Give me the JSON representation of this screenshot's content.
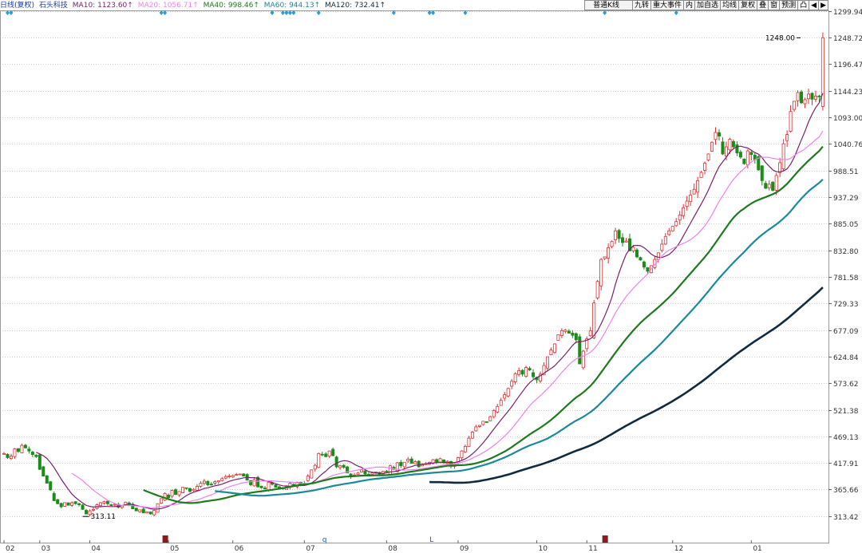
{
  "header": {
    "title": "日线(复权)",
    "stock": "石头科技",
    "indicators": [
      {
        "label": "MA10: 1123.60↑",
        "color": "#7a1f6e"
      },
      {
        "label": "MA20: 1056.71↑",
        "color": "#ee82ee"
      },
      {
        "label": "MA40: 998.46↑",
        "color": "#1e7a1e"
      },
      {
        "label": "MA60: 944.13↑",
        "color": "#1a8a99"
      },
      {
        "label": "MA120: 732.41↑",
        "color": "#102a40"
      }
    ]
  },
  "toolbar": {
    "items": [
      {
        "label": "普通K线",
        "name": "kline-type-select"
      },
      {
        "label": "九转",
        "name": "nine-turn-button"
      },
      {
        "label": "重大事件",
        "name": "major-events-button"
      },
      {
        "label": "内",
        "name": "inner-button"
      },
      {
        "label": "加自选",
        "name": "add-watchlist-button"
      },
      {
        "label": "均线",
        "name": "ma-button"
      },
      {
        "label": "复权",
        "name": "adjust-button"
      },
      {
        "label": "叠",
        "name": "overlay-button"
      },
      {
        "label": "窗",
        "name": "window-button"
      },
      {
        "label": "预测",
        "name": "forecast-button"
      },
      {
        "label": "凸",
        "name": "shape-button"
      },
      {
        "label": "◀",
        "name": "prev-button"
      },
      {
        "label": "▶",
        "name": "next-button"
      }
    ]
  },
  "chart_data": {
    "type": "candlestick",
    "y_ticks": [
      1299.94,
      1248.72,
      1196.47,
      1144.23,
      1093.0,
      1040.76,
      988.51,
      937.29,
      885.05,
      832.8,
      781.58,
      729.33,
      677.09,
      624.84,
      573.62,
      521.38,
      469.13,
      417.91,
      365.66,
      313.42
    ],
    "x_labels": [
      {
        "label": "02",
        "idx": 0
      },
      {
        "label": "03",
        "idx": 10
      },
      {
        "label": "04",
        "idx": 24
      },
      {
        "label": "05",
        "idx": 46
      },
      {
        "label": "06",
        "idx": 64
      },
      {
        "label": "07",
        "idx": 84
      },
      {
        "label": "08",
        "idx": 107
      },
      {
        "label": "09",
        "idx": 127
      },
      {
        "label": "10",
        "idx": 149
      },
      {
        "label": "11",
        "idx": 163
      },
      {
        "label": "12",
        "idx": 187
      },
      {
        "label": "01",
        "idx": 209
      }
    ],
    "annotations": {
      "high": {
        "label": "1248.00",
        "idx": 223,
        "value": 1248.0
      },
      "low": {
        "label": "313.11",
        "idx": 22,
        "value": 313.11
      }
    },
    "markers": [
      {
        "label": "q",
        "idx": 89
      },
      {
        "label": "L",
        "idx": 119
      }
    ],
    "closes": [
      436,
      428,
      431,
      445,
      440,
      452,
      447,
      441,
      434,
      430,
      405,
      392,
      378,
      365,
      344,
      338,
      332,
      340,
      335,
      340,
      338,
      336,
      327,
      318,
      324,
      327,
      336,
      340,
      342,
      338,
      336,
      337,
      331,
      334,
      341,
      336,
      328,
      324,
      326,
      320,
      322,
      318,
      325,
      338,
      348,
      358,
      350,
      364,
      356,
      362,
      370,
      368,
      362,
      366,
      372,
      378,
      382,
      375,
      376,
      381,
      383,
      387,
      391,
      392,
      393,
      395,
      396,
      392,
      384,
      375,
      385,
      371,
      369,
      368,
      380,
      376,
      370,
      368,
      367,
      372,
      378,
      372,
      380,
      375,
      378,
      392,
      404,
      413,
      436,
      434,
      430,
      441,
      432,
      410,
      412,
      409,
      398,
      391,
      394,
      398,
      404,
      396,
      395,
      398,
      400,
      396,
      401,
      400,
      412,
      405,
      418,
      412,
      419,
      425,
      417,
      420,
      410,
      414,
      416,
      419,
      424,
      420,
      426,
      418,
      421,
      411,
      416,
      428,
      441,
      450,
      466,
      478,
      488,
      491,
      499,
      498,
      508,
      520,
      528,
      540,
      551,
      563,
      577,
      592,
      598,
      591,
      604,
      599,
      586,
      580,
      591,
      608,
      625,
      638,
      650,
      668,
      676,
      677,
      671,
      667,
      658,
      611,
      636,
      660,
      676,
      730,
      772,
      815,
      820,
      838,
      850,
      871,
      856,
      848,
      851,
      832,
      839,
      820,
      814,
      800,
      792,
      803,
      815,
      828,
      845,
      860,
      871,
      880,
      889,
      902,
      916,
      929,
      941,
      952,
      969,
      985,
      1003,
      1021,
      1044,
      1063,
      1056,
      1021,
      1035,
      1050,
      1035,
      1023,
      1015,
      1002,
      1027,
      1020,
      1010,
      990,
      969,
      954,
      962,
      950,
      979,
      1004,
      1041,
      1059,
      1104,
      1124,
      1141,
      1121,
      1127,
      1138,
      1128,
      1134,
      1133,
      1248
    ],
    "ma": [
      {
        "name": "MA10",
        "color": "#7a1f6e",
        "width": 1,
        "values": [
          null,
          null,
          null,
          null,
          null,
          null,
          null,
          null,
          null,
          438.4,
          435.3,
          431.7,
          426.4,
          418.4,
          408.8,
          397.4,
          385.9,
          375.8,
          365.9,
          356.9,
          350.2,
          344.6,
          339.5,
          334.8,
          332.8,
          331.7,
          332.1,
          332.1,
          332.8,
          332.5,
          332.3,
          332.4,
          332.8,
          334.4,
          336.1,
          337.0,
          336.2,
          334.6,
          333.0,
          331.2,
          329.8,
          327.5,
          326.9,
          327.3,
          328.0,
          330.2,
          332.4,
          336.4,
          339.4,
          343.6,
          348.4,
          353.4,
          357.1,
          361.1,
          365.5,
          371.5,
          374.7,
          375.8,
          377.8,
          379.7,
          381.0,
          382.9,
          385.8,
          388.4,
          390.5,
          392.2,
          393.6,
          395.3,
          395.5,
          394.7,
          394.9,
          393.3,
          391.1,
          388.7,
          387.4,
          385.5,
          382.9,
          380.5,
          378.8,
          376.5,
          375.8,
          374.1,
          375.2,
          375.9,
          375.7,
          377.3,
          380.7,
          385.2,
          392.1,
          398.3,
          403.5,
          410.4,
          415.6,
          419.1,
          422.5,
          424.2,
          423.6,
          421.4,
          417.2,
          413.6,
          411.0,
          406.5,
          402.8,
          401.6,
          400.4,
          399.1,
          399.4,
          400.3,
          402.1,
          402.8,
          404.2,
          405.8,
          408.2,
          410.6,
          412.3,
          414.7,
          415.6,
          417.0,
          417.4,
          418.8,
          419.4,
          420.2,
          420.9,
          420.2,
          420.6,
          419.7,
          420.3,
          421.7,
          424.2,
          426.8,
          431.0,
          436.8,
          443.0,
          450.3,
          457.7,
          466.4,
          475.6,
          484.8,
          493.8,
          504.7,
          514.8,
          524.9,
          535.8,
          547.0,
          556.9,
          566.2,
          575.8,
          583.6,
          589.4,
          593.1,
          597.1,
          601.6,
          606.4,
          610.9,
          616.1,
          622.8,
          630.0,
          637.8,
          646.3,
          652.2,
          654.5,
          657.8,
          661.3,
          668.0,
          680.2,
          694.9,
          709.3,
          724.6,
          744.4,
          760.8,
          778.5,
          797.1,
          811.1,
          822.2,
          827.6,
          829.3,
          829.5,
          827.6,
          820.9,
          815.0,
          809.7,
          806.4,
          808.9,
          814.0,
          821.9,
          827.8,
          836.8,
          848.8,
          864.1,
          876.5,
          887.6,
          898.0,
          910.4,
          924.5,
          939.7,
          953.8,
          969.9,
          983.1,
          993.3,
          996.1,
          998.9,
          1001.4,
          1002.7,
          1004.4,
          1005.4,
          1001.4,
          992.7,
          984.3,
          977.0,
          971.4,
          968.5,
          968.6,
          970.3,
          973.2,
          982.8,
          996.2,
          1013.5,
          1028.5,
          1044.5,
          1063.3,
          1078.8,
          1092.8,
          1109.3,
          1139.0
        ]
      },
      {
        "name": "MA20",
        "color": "#ee82ee",
        "width": 1,
        "values": [
          null,
          null,
          null,
          null,
          null,
          null,
          null,
          null,
          null,
          null,
          null,
          null,
          null,
          null,
          null,
          null,
          null,
          null,
          null,
          397.7,
          393.4,
          388.1,
          383.0,
          376.7,
          370.8,
          364.6,
          359.0,
          354.0,
          349.4,
          344.7,
          341.3,
          338.5,
          336.1,
          334.6,
          334.4,
          334.3,
          334.1,
          333.4,
          332.9,
          331.8,
          331.0,
          330.0,
          329.8,
          330.9,
          332.0,
          333.6,
          334.3,
          335.5,
          336.2,
          337.4,
          339.1,
          340.5,
          342.0,
          344.2,
          346.8,
          350.4,
          353.7,
          356.6,
          359.4,
          362.3,
          364.7,
          368.1,
          371.4,
          374.7,
          378.0,
          381.8,
          384.1,
          385.6,
          386.6,
          387.2,
          387.9,
          388.1,
          388.4,
          388.5,
          388.9,
          388.9,
          388.2,
          387.9,
          387.2,
          385.6,
          385.3,
          383.7,
          383.2,
          382.3,
          381.6,
          381.4,
          381.8,
          382.9,
          385.4,
          387.4,
          389.6,
          392.2,
          395.4,
          397.8,
          400.0,
          401.2,
          402.3,
          403.2,
          404.7,
          406.0,
          407.3,
          408.5,
          409.2,
          410.4,
          411.4,
          411.7,
          411.5,
          410.8,
          409.7,
          408.2,
          407.6,
          406.1,
          405.5,
          406.1,
          406.3,
          406.8,
          407.5,
          408.7,
          409.8,
          410.8,
          411.8,
          413.0,
          414.6,
          415.4,
          416.5,
          417.3,
          418.3,
          419.8,
          421.3,
          423.8,
          426.0,
          428.7,
          431.8,
          434.9,
          438.0,
          441.0,
          444.3,
          448.0,
          451.8,
          456.6,
          462.2,
          468.6,
          475.2,
          482.1,
          489.4,
          496.6,
          503.9,
          510.4,
          518.0,
          525.4,
          531.8,
          537.4,
          543.4,
          549.9,
          556.6,
          562.8,
          568.8,
          575.6,
          582.6,
          590.1,
          598.2,
          607.2,
          615.8,
          621.4,
          627.2,
          633.3,
          641.2,
          652.9,
          664.8,
          675.9,
          686.5,
          699.2,
          713.6,
          729.3,
          745.9,
          760.2,
          773.4,
          786.4,
          795.0,
          802.0,
          808.2,
          814.3,
          820.6,
          826.3,
          830.0,
          833.4,
          835.0,
          836.3,
          838.6,
          844.0,
          849.8,
          854.1,
          856.1,
          858.1,
          861.8,
          866.8,
          873.6,
          881.6,
          891.0,
          901.4,
          913.2,
          926.3,
          938.5,
          949.6,
          958.8,
          968.2,
          977.4,
          985.8,
          994.5,
          1000.1,
          1004.4,
          1008.5,
          1012.2,
          1017.2,
          1024.4,
          1033.6,
          1045.4,
          1059.7,
          1075.6,
          1089.6,
          1108.8
        ]
      },
      {
        "name": "MA40",
        "color": "#1e7a1e",
        "width": 2.2,
        "startIdx": 38,
        "values": [
          null,
          null,
          null,
          null,
          null,
          null,
          null,
          null,
          null,
          null,
          null,
          null,
          null,
          null,
          null,
          null,
          null,
          null,
          null,
          null,
          null,
          null,
          null,
          null,
          null,
          null,
          null,
          null,
          null,
          null,
          null,
          null,
          null,
          null,
          null,
          null,
          null,
          null,
          null,
          null,
          null,
          null,
          null,
          null,
          null,
          null,
          null,
          null,
          null,
          null,
          null,
          null,
          null,
          null,
          null,
          null,
          null,
          null,
          null,
          null,
          null,
          null,
          null,
          null,
          null,
          null,
          null,
          null,
          null,
          null,
          null,
          null,
          null,
          null,
          null,
          null,
          null,
          null,
          null,
          null,
          null,
          null,
          null,
          null,
          null,
          null,
          null,
          null,
          null,
          null,
          null,
          null,
          null,
          null,
          null,
          null,
          null,
          null,
          null,
          null,
          null,
          null,
          null,
          null,
          null,
          null,
          null,
          null,
          null,
          null,
          null,
          null,
          null,
          null,
          null,
          null,
          null,
          null,
          null,
          null,
          null,
          null,
          null,
          null,
          null,
          null,
          null,
          null,
          null,
          null,
          null,
          null,
          null,
          null,
          null,
          null,
          null,
          null,
          null,
          null,
          null,
          null,
          null,
          null,
          null,
          null,
          null,
          null,
          null,
          null,
          null,
          null,
          null,
          null,
          null,
          null,
          null,
          null,
          null,
          null,
          null,
          null,
          null,
          null,
          null,
          null,
          null,
          null,
          null,
          null,
          null,
          null,
          null,
          null,
          null,
          null,
          null,
          null,
          null,
          null,
          null,
          null,
          null,
          null,
          null,
          null,
          null,
          null,
          null,
          null,
          null,
          null,
          null,
          null,
          null,
          null,
          null,
          null,
          null,
          null,
          null,
          null,
          null,
          null,
          null,
          null,
          null,
          null,
          null,
          null,
          null,
          null,
          null,
          null,
          null,
          null,
          null,
          null,
          null,
          null,
          null,
          null,
          null,
          null,
          null,
          null,
          null,
          null,
          null
        ]
      },
      {
        "name": "MA60",
        "color": "#1a8a99",
        "width": 2.2,
        "values": []
      },
      {
        "name": "MA120",
        "color": "#102a40",
        "width": 2.6,
        "values": []
      }
    ]
  }
}
